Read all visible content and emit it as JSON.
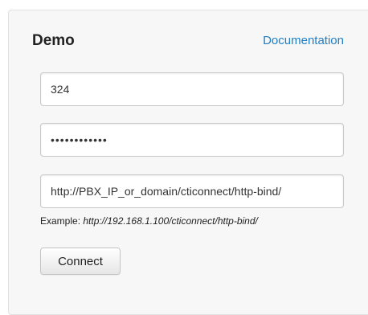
{
  "form": {
    "title": "Demo",
    "doc_link": "Documentation",
    "user_value": "324",
    "password_value": "••••••••••••",
    "url_value": "http://PBX_IP_or_domain/cticonnect/http-bind/",
    "example_label": "Example: ",
    "example_url": "http://192.168.1.100/cticonnect/http-bind/",
    "connect_label": "Connect"
  },
  "colors": {
    "link": "#1f7ec4",
    "panel": "#f7f7f7"
  }
}
